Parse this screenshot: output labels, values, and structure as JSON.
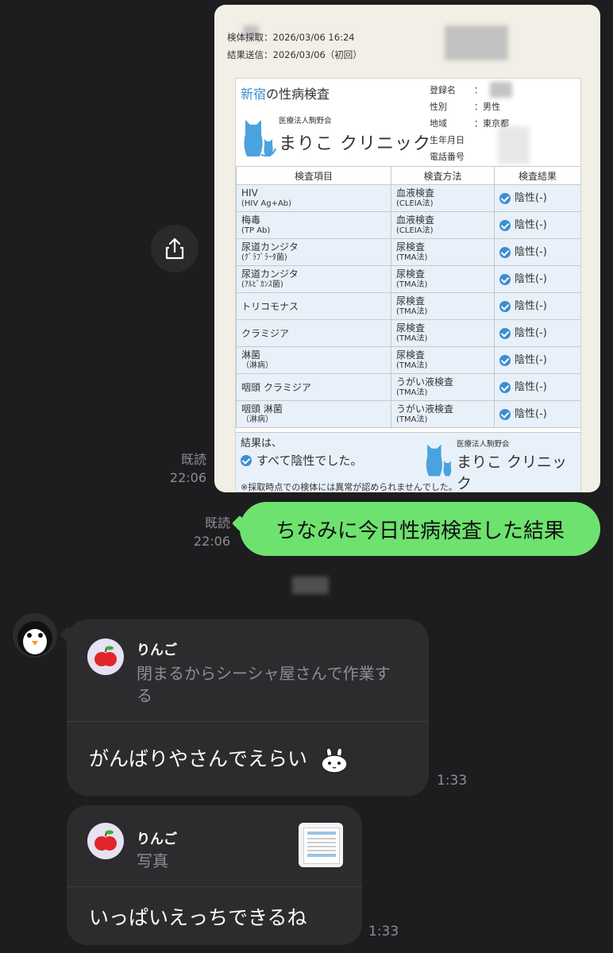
{
  "shared_image": {
    "collection_date": "検体採取：2026/03/06 16:24",
    "result_date": "結果送信：2026/03/06（初回）",
    "report": {
      "title_accent": "新宿",
      "title_rest": "の性病検査",
      "org_prefix": "医療法人駒野会",
      "org_name": "まりこ クリニック",
      "profile": [
        {
          "key": "登録名",
          "value": "："
        },
        {
          "key": "性別",
          "value": "：男性"
        },
        {
          "key": "地域",
          "value": "：東京都"
        },
        {
          "key": "生年月日",
          "value": ""
        },
        {
          "key": "電話番号",
          "value": ""
        }
      ],
      "headers": [
        "検査項目",
        "検査方法",
        "検査結果"
      ],
      "rows": [
        {
          "item": "HIV",
          "item_sub": "(HIV Ag+Ab)",
          "method": "血液検査",
          "method_sub": "(CLEIA法)",
          "result": "陰性(-)"
        },
        {
          "item": "梅毒",
          "item_sub": "(TP Ab)",
          "method": "血液検査",
          "method_sub": "(CLEIA法)",
          "result": "陰性(-)"
        },
        {
          "item": "尿道カンジタ",
          "item_sub": "(ｸﾞﾗﾌﾞﾗｰﾀ菌)",
          "method": "尿検査",
          "method_sub": "(TMA法)",
          "result": "陰性(-)"
        },
        {
          "item": "尿道カンジタ",
          "item_sub": "(ｱﾙﾋﾞｶﾝｽ菌)",
          "method": "尿検査",
          "method_sub": "(TMA法)",
          "result": "陰性(-)"
        },
        {
          "item": "トリコモナス",
          "item_sub": "",
          "method": "尿検査",
          "method_sub": "(TMA法)",
          "result": "陰性(-)"
        },
        {
          "item": "クラミジア",
          "item_sub": "",
          "method": "尿検査",
          "method_sub": "(TMA法)",
          "result": "陰性(-)"
        },
        {
          "item": "淋菌",
          "item_sub": "（淋病）",
          "method": "尿検査",
          "method_sub": "(TMA法)",
          "result": "陰性(-)"
        },
        {
          "item": "咽頭 クラミジア",
          "item_sub": "",
          "method": "うがい液検査",
          "method_sub": "(TMA法)",
          "result": "陰性(-)"
        },
        {
          "item": "咽頭 淋菌",
          "item_sub": "（淋病）",
          "method": "うがい液検査",
          "method_sub": "(TMA法)",
          "result": "陰性(-)"
        }
      ],
      "summary_label": "結果は、",
      "summary_main": "すべて陰性でした。",
      "summary_note": "※採取時点での検体には異常が認められませんでした。"
    }
  },
  "read_receipts": [
    {
      "status": "既読",
      "time": "22:06"
    },
    {
      "status": "既読",
      "time": "22:06"
    }
  ],
  "sent_message": "ちなみに今日性病検査した結果",
  "received": [
    {
      "reply_name": "りんご",
      "reply_text_line1": "閉まるからシーシャ屋さんで作業す",
      "reply_text_line2": "る",
      "text": "がんばりやさんでえらい",
      "time": "1:33"
    },
    {
      "reply_name": "りんご",
      "reply_text_line1": "写真",
      "text": "いっぱいえっちできるね",
      "time": "1:33"
    }
  ],
  "colors": {
    "background": "#1d1d1f",
    "sent_bubble": "#6ee26e",
    "received_bubble": "#2c2c2e",
    "meta_text": "#8e8e93",
    "report_accent": "#3b8ed0"
  },
  "icons": [
    "share-icon",
    "penguin-avatar-icon",
    "apple-icon",
    "bunny-emoji-icon",
    "check-circle-icon",
    "cat-logo-icon"
  ]
}
